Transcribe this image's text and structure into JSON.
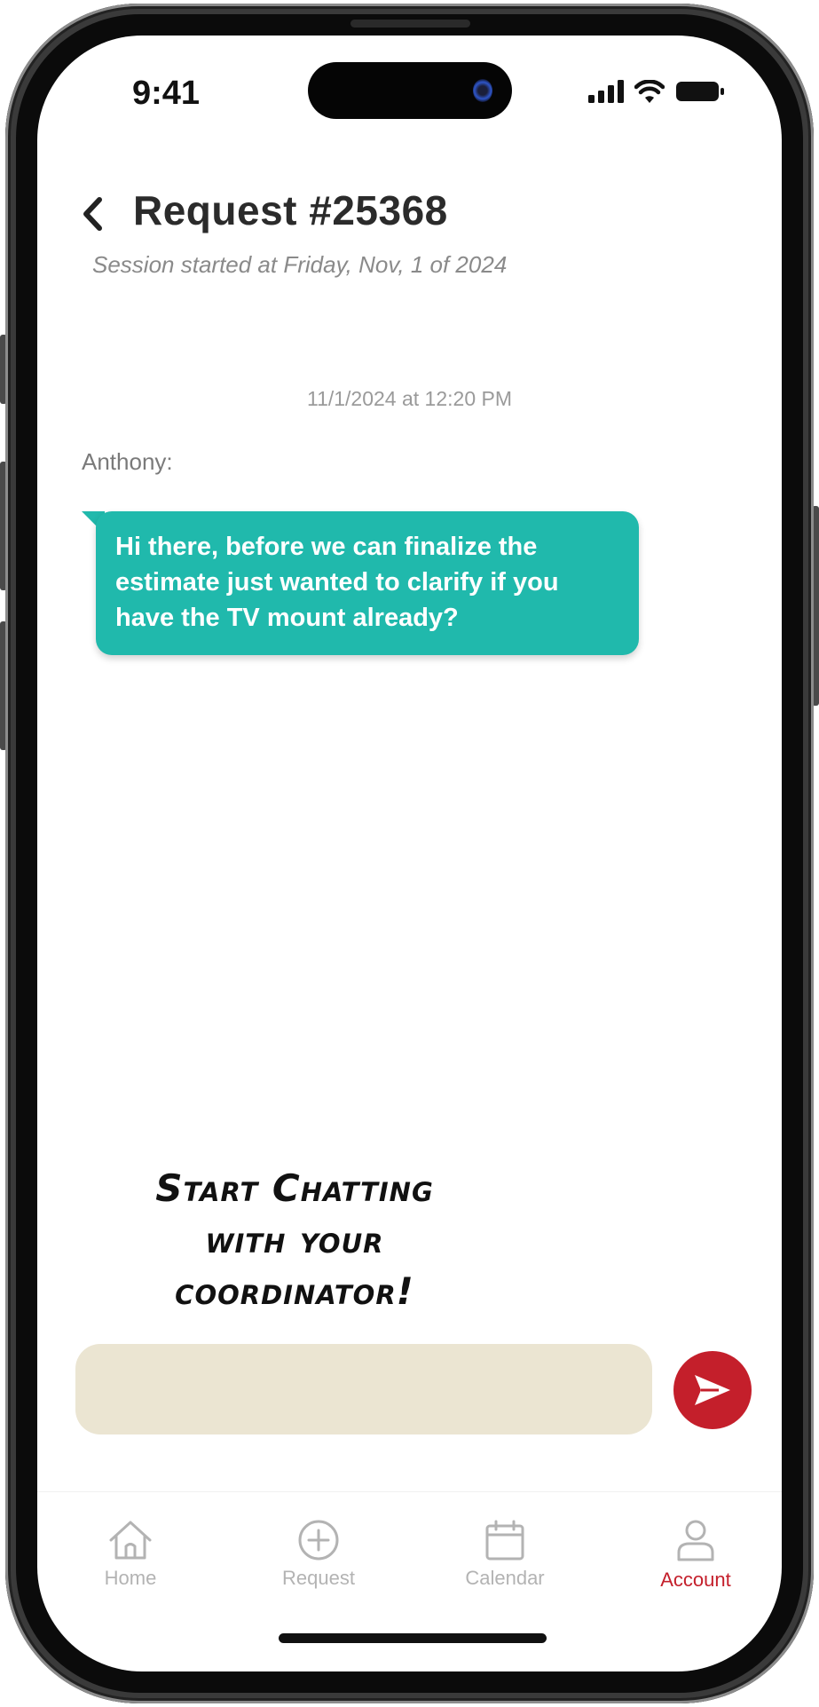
{
  "status_bar": {
    "time": "9:41",
    "icons": [
      "signal-icon",
      "wifi-icon",
      "battery-icon"
    ]
  },
  "header": {
    "back_icon": "chevron-left-icon",
    "title": "Request #25368",
    "subtitle": "Session started at Friday, Nov, 1 of 2024"
  },
  "chat": {
    "timestamp": "11/1/2024 at 12:20 PM",
    "messages": [
      {
        "sender": "Anthony:",
        "text": "Hi there, before we can finalize the estimate just wanted to clarify if you have the TV mount already?"
      }
    ]
  },
  "annotation": {
    "lines": [
      "Start Chatting",
      "with your",
      "coordinator!"
    ]
  },
  "composer": {
    "value": "",
    "placeholder": "",
    "send_icon": "send-icon"
  },
  "tabs": [
    {
      "label": "Home",
      "icon": "home-icon",
      "active": false
    },
    {
      "label": "Request",
      "icon": "plus-circle-icon",
      "active": false
    },
    {
      "label": "Calendar",
      "icon": "calendar-icon",
      "active": false
    },
    {
      "label": "Account",
      "icon": "user-icon",
      "active": true
    }
  ],
  "colors": {
    "accent": "#c41f2b",
    "bubble": "#20b9ac",
    "input_bg": "#ebe5d2",
    "tab_inactive": "#b3b3b3"
  }
}
